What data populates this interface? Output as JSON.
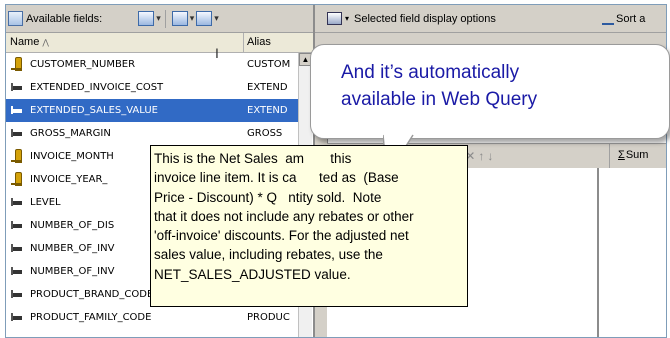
{
  "left": {
    "toolbar_label": "Available fields:",
    "column_name": "Name",
    "column_alias": "Alias",
    "rows": [
      {
        "name": "CUSTOMER_NUMBER",
        "alias": "CUSTOM",
        "icon": "key-icon"
      },
      {
        "name": "EXTENDED_INVOICE_COST",
        "alias": "EXTEND",
        "icon": "measure-icon"
      },
      {
        "name": "EXTENDED_SALES_VALUE",
        "alias": "EXTEND",
        "icon": "measure-icon",
        "selected": true
      },
      {
        "name": "GROSS_MARGIN",
        "alias": "GROSS",
        "icon": "measure-icon"
      },
      {
        "name": "INVOICE_MONTH",
        "alias": "",
        "icon": "key-icon"
      },
      {
        "name": "INVOICE_YEAR_",
        "alias": "",
        "icon": "key-icon"
      },
      {
        "name": "LEVEL",
        "alias": "",
        "icon": "measure-icon"
      },
      {
        "name": "NUMBER_OF_DIS",
        "alias": "",
        "icon": "measure-icon"
      },
      {
        "name": "NUMBER_OF_INV",
        "alias": "",
        "icon": "measure-icon"
      },
      {
        "name": "NUMBER_OF_INV",
        "alias": "",
        "icon": "measure-icon"
      },
      {
        "name": "PRODUCT_BRAND_CODE",
        "alias": "PRODUC",
        "icon": "measure-icon"
      },
      {
        "name": "PRODUCT_FAMILY_CODE",
        "alias": "PRODUC",
        "icon": "measure-icon"
      }
    ]
  },
  "right": {
    "display_options_label": "Selected field display options",
    "sort_label": "Sort a",
    "sum_label": "Sum"
  },
  "callout": {
    "line1": "And it’s automatically",
    "line2": "available in Web Query"
  },
  "tooltip": {
    "lines": [
      "This is the Net Sales  am       this",
      "invoice line item. It is ca      ted as  (Base",
      "Price - Discount) * Q   ntity sold.  Note",
      "that it does not include any rebates or other",
      "'off-invoice' discounts. For the adjusted net",
      "sales value, including rebates, use the",
      "NET_SALES_ADJUSTED value."
    ]
  },
  "colors": {
    "selection": "#316ac5",
    "tooltip_bg": "#ffffe1",
    "callout_text": "#1a1aa6",
    "chrome": "#d4d0c8"
  }
}
